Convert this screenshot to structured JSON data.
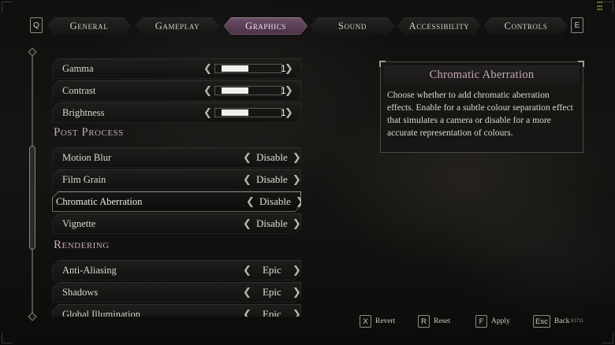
{
  "nav": {
    "left_key": "Q",
    "right_key": "E",
    "tabs": [
      {
        "label": "General"
      },
      {
        "label": "Gameplay"
      },
      {
        "label": "Graphics"
      },
      {
        "label": "Sound"
      },
      {
        "label": "Accessibility"
      },
      {
        "label": "Controls"
      }
    ],
    "active_tab": "Graphics"
  },
  "settings": {
    "gamma": {
      "label": "Gamma",
      "value": "1",
      "level": 0.4
    },
    "contrast": {
      "label": "Contrast",
      "value": "1",
      "level": 0.4
    },
    "brightness": {
      "label": "Brightness",
      "value": "1",
      "level": 0.4
    },
    "post_process_header": "Post Process",
    "motion_blur": {
      "label": "Motion Blur",
      "value": "Disable"
    },
    "film_grain": {
      "label": "Film Grain",
      "value": "Disable"
    },
    "chromatic_aberration": {
      "label": "Chromatic Aberration",
      "value": "Disable"
    },
    "vignette": {
      "label": "Vignette",
      "value": "Disable"
    },
    "rendering_header": "Rendering",
    "anti_aliasing": {
      "label": "Anti-Aliasing",
      "value": "Epic"
    },
    "shadows": {
      "label": "Shadows",
      "value": "Epic"
    },
    "global_illumination": {
      "label": "Global Illumination",
      "value": "Epic"
    }
  },
  "info": {
    "title": "Chromatic Aberration",
    "description": "Choose whether to add chromatic aberration effects. Enable for a subtle colour separation effect that simulates a camera or disable for a more accurate representation of colours."
  },
  "prompts": [
    {
      "key": "X",
      "label": "Revert"
    },
    {
      "key": "R",
      "label": "Reset"
    },
    {
      "key": "F",
      "label": "Apply"
    },
    {
      "key": "Esc",
      "label": "Back"
    }
  ],
  "build_number": "81711",
  "colors": {
    "accent_pink": "#c7a9bd",
    "active_tab": "#6e5468",
    "text": "#ddd7cb",
    "background": "#121211"
  }
}
